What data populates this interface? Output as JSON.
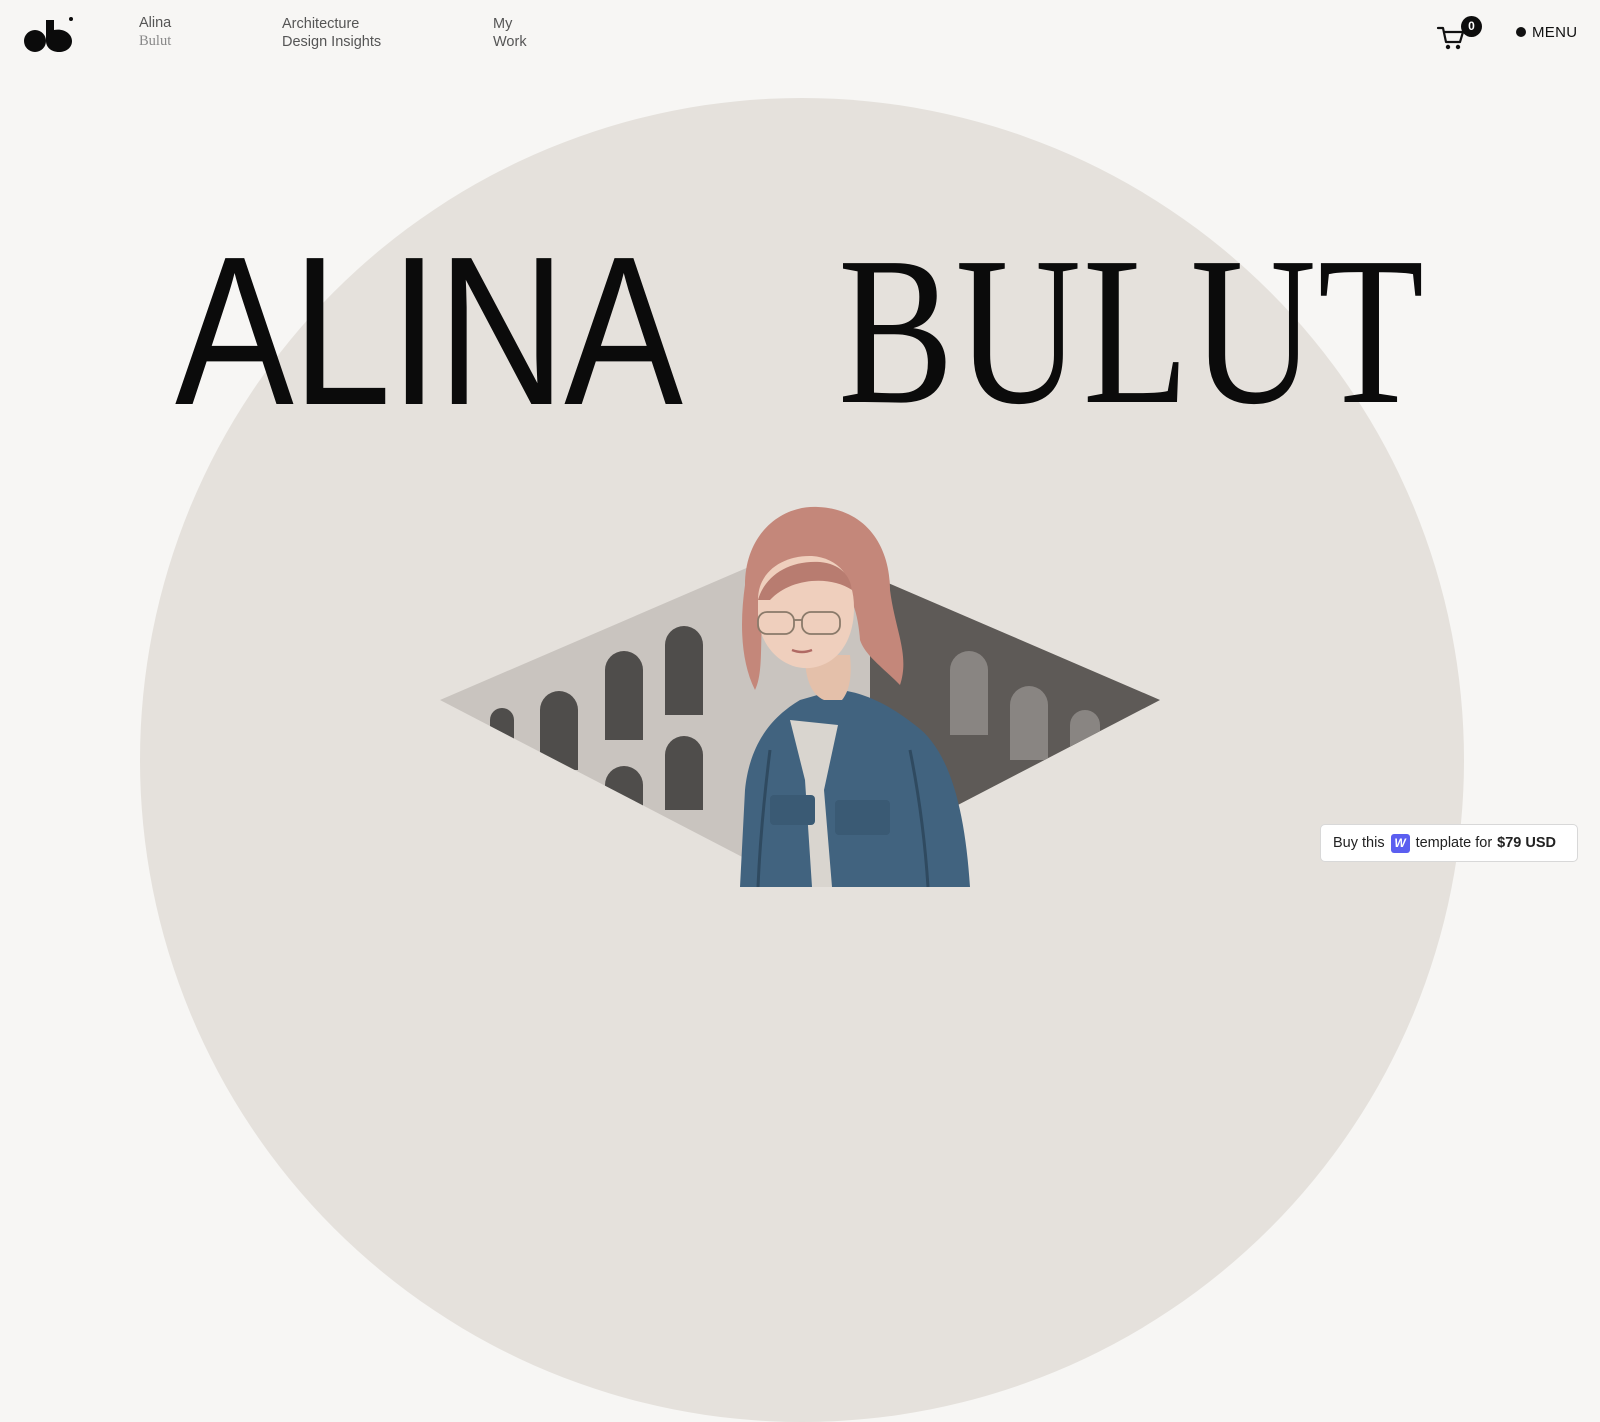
{
  "header": {
    "logo_icon": "ab-logo-icon",
    "brand": {
      "line1": "Alina",
      "line2": "Bulut"
    },
    "nav": [
      {
        "line1": "Architecture",
        "line2": "Design Insights"
      },
      {
        "line1": "My",
        "line2": "Work"
      }
    ],
    "cart": {
      "icon": "cart-icon",
      "count": "0"
    },
    "menu_label": "MENU"
  },
  "hero": {
    "first_name": "ALINA",
    "last_name": "BULUT",
    "circle_color": "#e5e1dc"
  },
  "badge": {
    "prefix": "Buy this",
    "w_icon": "webflow-icon",
    "w_letter": "W",
    "middle": "template for",
    "price": "$79 USD",
    "accent": "#5b5ef0"
  }
}
